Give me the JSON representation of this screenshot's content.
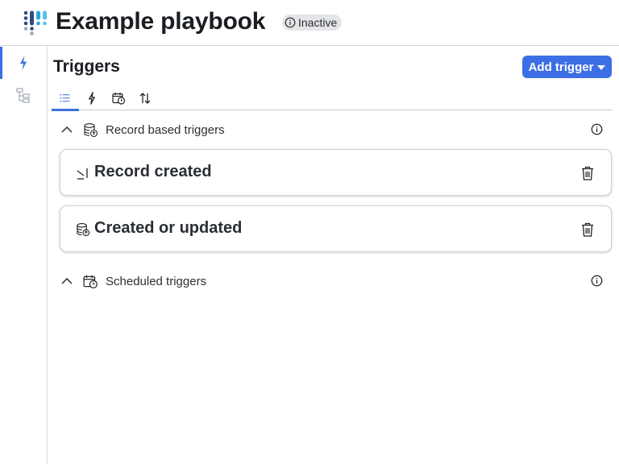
{
  "header": {
    "title": "Example playbook",
    "status": "Inactive",
    "logo_icon": "brand-dots-logo"
  },
  "rail": {
    "items": [
      {
        "icon": "lightning-icon",
        "active": true
      },
      {
        "icon": "tree-structure-icon",
        "active": false
      }
    ]
  },
  "panel": {
    "title": "Triggers",
    "add_button_label": "Add trigger"
  },
  "tabs": [
    {
      "icon": "list-icon",
      "active": true
    },
    {
      "icon": "lightning-icon",
      "active": false
    },
    {
      "icon": "calendar-clock-icon",
      "active": false
    },
    {
      "icon": "sort-arrows-icon",
      "active": false
    }
  ],
  "sections": [
    {
      "label": "Record based triggers",
      "expanded": true,
      "icon": "database-up-icon",
      "items": [
        {
          "label": "Record created",
          "icon": "record-created-icon"
        },
        {
          "label": "Created or updated",
          "icon": "database-up-icon"
        }
      ]
    },
    {
      "label": "Scheduled triggers",
      "expanded": true,
      "icon": "calendar-clock-icon",
      "items": []
    }
  ],
  "colors": {
    "accent": "#3c6fe3",
    "border": "#d4d7dc",
    "badge_bg": "#e4e5e7"
  }
}
